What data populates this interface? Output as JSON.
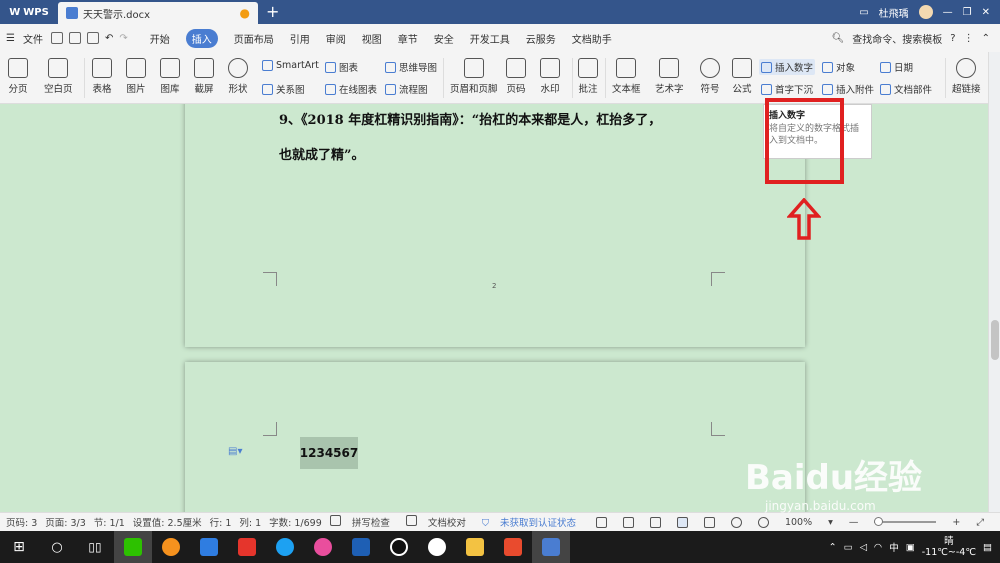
{
  "titlebar": {
    "app": "WPS",
    "doc_tab": "天天警示.docx",
    "user": "杜飛瑀"
  },
  "menubar": {
    "file": "文件",
    "tabs": [
      "开始",
      "插入",
      "页面布局",
      "引用",
      "审阅",
      "视图",
      "章节",
      "安全",
      "开发工具",
      "云服务",
      "文档助手"
    ],
    "active_tab": "插入",
    "search": "查找命令、搜索模板"
  },
  "ribbon": {
    "page_break": "分页",
    "blank_page": "空白页",
    "table": "表格",
    "picture": "图片",
    "gallery": "图库",
    "screenshot": "截屏",
    "shape": "形状",
    "smartart": "SmartArt",
    "relation": "关系图",
    "chart": "图表",
    "online_chart": "在线图表",
    "mindmap": "思维导图",
    "flowchart": "流程图",
    "header_footer": "页眉和页脚",
    "page_number": "页码",
    "watermark": "水印",
    "comment": "批注",
    "textbox": "文本框",
    "wordart": "艺术字",
    "symbol": "符号",
    "formula": "公式",
    "insert_number": "插入数字",
    "drop_cap": "首字下沉",
    "object": "对象",
    "attachment": "插入附件",
    "date": "日期",
    "doc_parts": "文档部件",
    "hyperlink": "超链接"
  },
  "tooltip": {
    "title": "插入数字",
    "desc": "将自定义的数字格式插入到文档中。"
  },
  "document": {
    "line1": "9、《2018 年度杠精识别指南》：“抬杠的本来都是人，杠抬多了，",
    "line2": "也就成了精”。",
    "page_no": "2",
    "inserted_number": "1234567"
  },
  "status": {
    "page": "页码: 3",
    "pages": "页面: 3/3",
    "section": "节: 1/1",
    "setting": "设置值: 2.5厘米",
    "row": "行: 1",
    "col": "列: 1",
    "words": "字数: 1/699",
    "spell": "拼写检查",
    "proof": "文档校对",
    "auth": "未获取到认证状态",
    "zoom": "100%"
  },
  "taskbar": {
    "ime": "中",
    "weather": "晴",
    "temp": "-11℃~-4℃"
  },
  "watermark": {
    "brand": "Baidu经验",
    "url": "jingyan.baidu.com"
  },
  "colors": {
    "title_bar": "#34558b",
    "accent": "#4a7dd1",
    "page_bg": "#cce8cf",
    "highlight_red": "#e02020"
  }
}
